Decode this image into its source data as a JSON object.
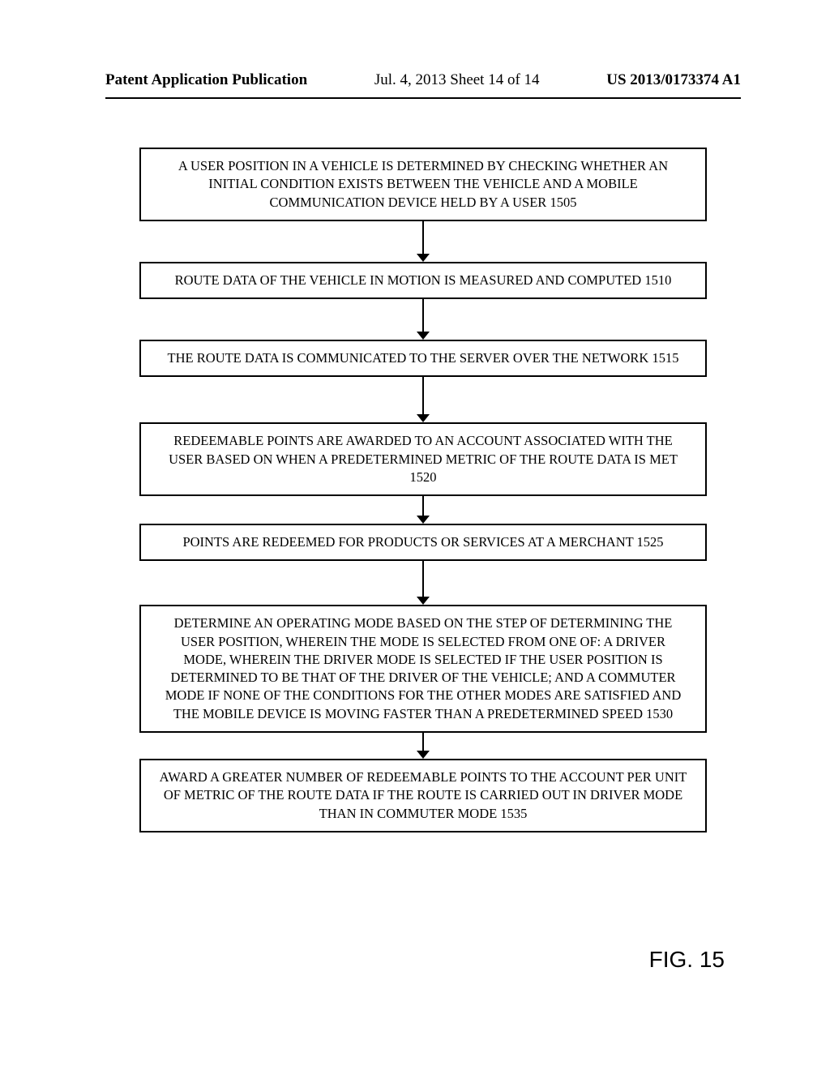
{
  "header": {
    "left": "Patent Application Publication",
    "center": "Jul. 4, 2013  Sheet 14 of 14",
    "right": "US 2013/0173374 A1"
  },
  "flow": {
    "steps": [
      "A USER POSITION IN A VEHICLE IS DETERMINED BY CHECKING WHETHER AN INITIAL CONDITION EXISTS BETWEEN THE VEHICLE AND A MOBILE COMMUNICATION DEVICE HELD BY A USER 1505",
      "ROUTE DATA OF THE VEHICLE IN MOTION IS MEASURED AND COMPUTED 1510",
      "THE ROUTE DATA IS COMMUNICATED TO THE SERVER OVER THE NETWORK 1515",
      "REDEEMABLE POINTS ARE AWARDED TO AN ACCOUNT ASSOCIATED WITH THE USER BASED ON WHEN A PREDETERMINED METRIC OF THE ROUTE DATA IS MET 1520",
      "POINTS ARE REDEEMED FOR PRODUCTS OR SERVICES AT A MERCHANT 1525",
      "DETERMINE AN OPERATING MODE BASED ON THE STEP OF DETERMINING THE USER POSITION, WHEREIN THE MODE IS SELECTED FROM ONE OF: A DRIVER MODE, WHEREIN THE DRIVER MODE IS SELECTED IF THE USER POSITION IS DETERMINED TO BE THAT OF THE DRIVER OF THE VEHICLE; AND A COMMUTER MODE IF NONE OF THE CONDITIONS FOR THE OTHER MODES ARE SATISFIED AND THE MOBILE DEVICE IS MOVING FASTER THAN A PREDETERMINED SPEED 1530",
      "AWARD A GREATER NUMBER OF REDEEMABLE POINTS TO THE ACCOUNT PER UNIT OF METRIC OF THE ROUTE DATA IF THE ROUTE IS CARRIED OUT IN DRIVER MODE THAN IN COMMUTER MODE 1535"
    ],
    "arrow_heights": [
      50,
      50,
      56,
      34,
      54,
      32
    ]
  },
  "figure_label": "FIG. 15"
}
